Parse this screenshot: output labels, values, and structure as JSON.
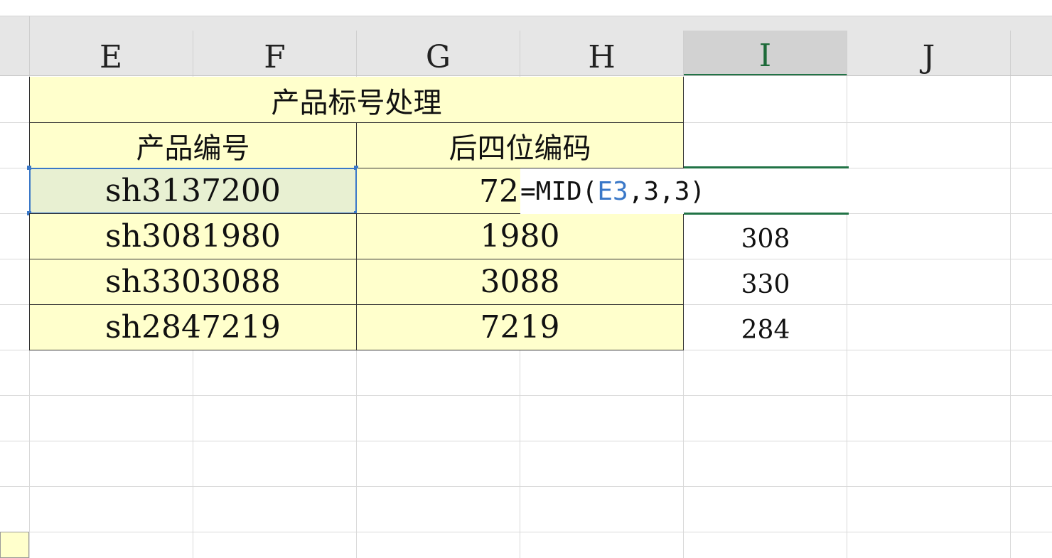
{
  "columns": [
    {
      "label": "E",
      "active": false
    },
    {
      "label": "F",
      "active": false
    },
    {
      "label": "G",
      "active": false
    },
    {
      "label": "H",
      "active": false
    },
    {
      "label": "I",
      "active": true
    },
    {
      "label": "J",
      "active": false
    }
  ],
  "table": {
    "title": "产品标号处理",
    "headers": [
      "产品编号",
      "后四位编码"
    ],
    "rows": [
      {
        "code": "sh3137200",
        "last4": "72"
      },
      {
        "code": "sh3081980",
        "last4": "1980"
      },
      {
        "code": "sh3303088",
        "last4": "3088"
      },
      {
        "code": "sh2847219",
        "last4": "7219"
      }
    ]
  },
  "column_i": [
    "",
    "308",
    "330",
    "284"
  ],
  "formula": {
    "prefix": "=MID(",
    "ref": "E3",
    "suffix": ",3,3)"
  },
  "colors": {
    "fill": "#ffffcc",
    "selection": "#3a78c8",
    "active_header": "#217346"
  }
}
